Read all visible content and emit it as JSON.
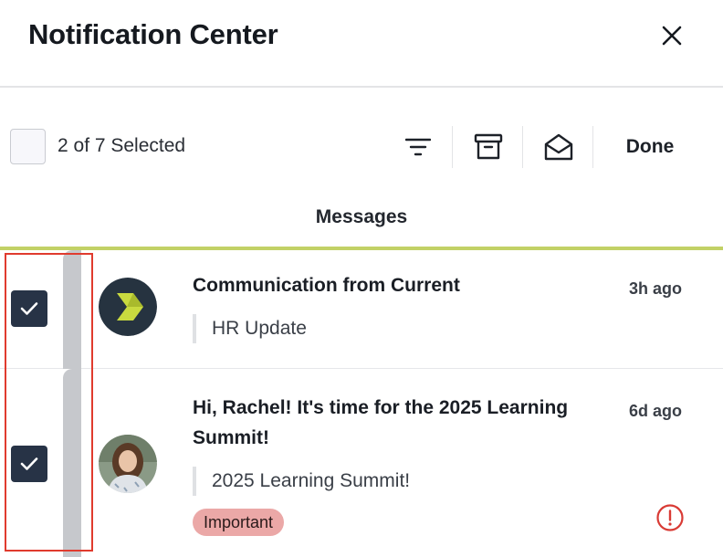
{
  "header": {
    "title": "Notification Center"
  },
  "toolbar": {
    "selected_count": "2 of 7 Selected",
    "done_label": "Done",
    "icons": [
      "filter-icon",
      "archive-icon",
      "envelope-open-icon"
    ]
  },
  "tab": {
    "label": "Messages",
    "accent_color": "#c2d166"
  },
  "messages": [
    {
      "title": "Communication from Current",
      "time": "3h ago",
      "preview": "HR Update",
      "selected": true
    },
    {
      "title": "Hi, Rachel! It's time for the 2025 Learning Summit!",
      "time": "6d ago",
      "preview": "2025 Learning Summit!",
      "badge": "Important",
      "selected": true
    }
  ],
  "colors": {
    "checkbox": "#273346",
    "badge": "#eba8a7",
    "alert": "#d93b35",
    "highlight": "#e03b2e"
  }
}
